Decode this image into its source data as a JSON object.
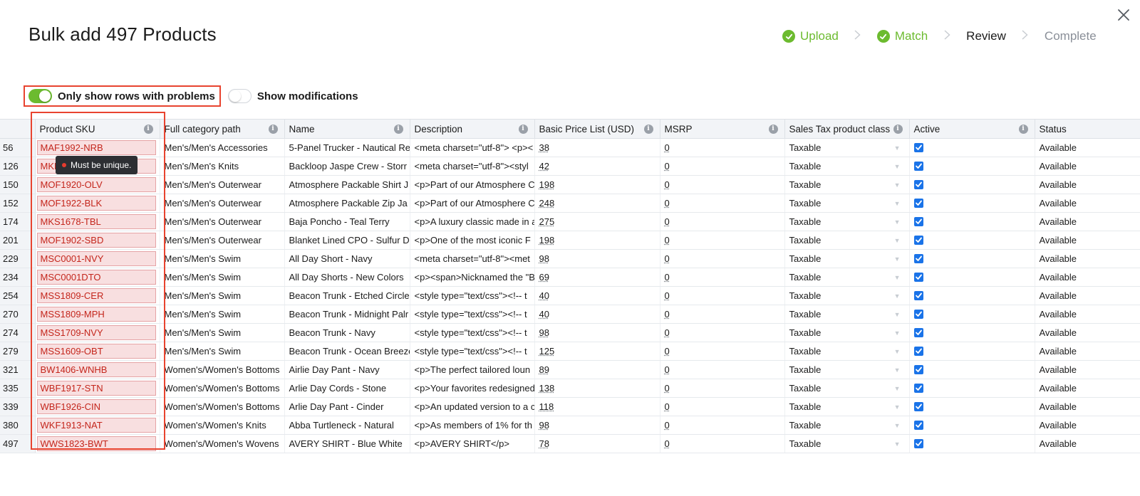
{
  "header": {
    "title": "Bulk add 497 Products",
    "steps": [
      {
        "label": "Upload",
        "state": "done"
      },
      {
        "label": "Match",
        "state": "done"
      },
      {
        "label": "Review",
        "state": "current"
      },
      {
        "label": "Complete",
        "state": "pending"
      }
    ]
  },
  "toggles": {
    "problems_label": "Only show rows with problems",
    "problems_on": true,
    "modifications_label": "Show modifications",
    "modifications_on": false
  },
  "tooltip": "Must be unique.",
  "columns": [
    "Product SKU",
    "Full category path",
    "Name",
    "Description",
    "Basic Price List (USD)",
    "MSRP",
    "Sales Tax product class",
    "Active",
    "Status"
  ],
  "rows": [
    {
      "num": "56",
      "sku": "MAF1992-NRB",
      "category": "Men's/Men's Accessories",
      "name": "5-Panel Trucker - Nautical Re",
      "description": "<meta charset=\"utf-8\"> <p><",
      "price": "38",
      "msrp": "0",
      "tax": "Taxable",
      "active": true,
      "status": "Available"
    },
    {
      "num": "126",
      "sku": "MKF",
      "category": "Men's/Men's Knits",
      "name": "Backloop Jaspe Crew - Storr",
      "description": "<meta charset=\"utf-8\"><styl",
      "price": "42",
      "msrp": "0",
      "tax": "Taxable",
      "active": true,
      "status": "Available"
    },
    {
      "num": "150",
      "sku": "MOF1920-OLV",
      "category": "Men's/Men's Outerwear",
      "name": "Atmosphere Packable Shirt J",
      "description": "<p>Part of our Atmosphere C",
      "price": "198",
      "msrp": "0",
      "tax": "Taxable",
      "active": true,
      "status": "Available"
    },
    {
      "num": "152",
      "sku": "MOF1922-BLK",
      "category": "Men's/Men's Outerwear",
      "name": "Atmosphere Packable Zip Ja",
      "description": "<p>Part of our Atmosphere C",
      "price": "248",
      "msrp": "0",
      "tax": "Taxable",
      "active": true,
      "status": "Available"
    },
    {
      "num": "174",
      "sku": "MKS1678-TBL",
      "category": "Men's/Men's Outerwear",
      "name": "Baja Poncho - Teal Terry",
      "description": "<p>A luxury classic made in a",
      "price": "275",
      "msrp": "0",
      "tax": "Taxable",
      "active": true,
      "status": "Available"
    },
    {
      "num": "201",
      "sku": "MOF1902-SBD",
      "category": "Men's/Men's Outerwear",
      "name": "Blanket Lined CPO - Sulfur D",
      "description": "<p>One of the most iconic F",
      "price": "198",
      "msrp": "0",
      "tax": "Taxable",
      "active": true,
      "status": "Available"
    },
    {
      "num": "229",
      "sku": "MSC0001-NVY",
      "category": "Men's/Men's Swim",
      "name": "All Day Short - Navy",
      "description": "<meta charset=\"utf-8\"><met",
      "price": "98",
      "msrp": "0",
      "tax": "Taxable",
      "active": true,
      "status": "Available"
    },
    {
      "num": "234",
      "sku": "MSC0001DTO",
      "category": "Men's/Men's Swim",
      "name": "All Day Shorts - New Colors",
      "description": "<p><span>Nicknamed the \"B",
      "price": "69",
      "msrp": "0",
      "tax": "Taxable",
      "active": true,
      "status": "Available"
    },
    {
      "num": "254",
      "sku": "MSS1809-CER",
      "category": "Men's/Men's Swim",
      "name": "Beacon Trunk - Etched Circle",
      "description": "<style type=\"text/css\"><!-- t",
      "price": "40",
      "msrp": "0",
      "tax": "Taxable",
      "active": true,
      "status": "Available"
    },
    {
      "num": "270",
      "sku": "MSS1809-MPH",
      "category": "Men's/Men's Swim",
      "name": "Beacon Trunk - Midnight Palr",
      "description": "<style type=\"text/css\"><!-- t",
      "price": "40",
      "msrp": "0",
      "tax": "Taxable",
      "active": true,
      "status": "Available"
    },
    {
      "num": "274",
      "sku": "MSS1709-NVY",
      "category": "Men's/Men's Swim",
      "name": "Beacon Trunk - Navy",
      "description": "<style type=\"text/css\"><!-- t",
      "price": "98",
      "msrp": "0",
      "tax": "Taxable",
      "active": true,
      "status": "Available"
    },
    {
      "num": "279",
      "sku": "MSS1609-OBT",
      "category": "Men's/Men's Swim",
      "name": "Beacon Trunk - Ocean Breeze",
      "description": "<style type=\"text/css\"><!-- t",
      "price": "125",
      "msrp": "0",
      "tax": "Taxable",
      "active": true,
      "status": "Available"
    },
    {
      "num": "321",
      "sku": "BW1406-WNHB",
      "category": "Women's/Women's Bottoms",
      "name": "Airlie Day Pant - Navy",
      "description": "<p>The perfect tailored loun",
      "price": "89",
      "msrp": "0",
      "tax": "Taxable",
      "active": true,
      "status": "Available"
    },
    {
      "num": "335",
      "sku": "WBF1917-STN",
      "category": "Women's/Women's Bottoms",
      "name": "Arlie Day Cords - Stone",
      "description": "<p>Your favorites redesigned",
      "price": "138",
      "msrp": "0",
      "tax": "Taxable",
      "active": true,
      "status": "Available"
    },
    {
      "num": "339",
      "sku": "WBF1926-CIN",
      "category": "Women's/Women's Bottoms",
      "name": "Arlie Day Pant - Cinder",
      "description": "<p>An updated version to a c",
      "price": "118",
      "msrp": "0",
      "tax": "Taxable",
      "active": true,
      "status": "Available"
    },
    {
      "num": "380",
      "sku": "WKF1913-NAT",
      "category": "Women's/Women's Knits",
      "name": "Abba Turtleneck - Natural",
      "description": "<p>As members of 1% for th",
      "price": "98",
      "msrp": "0",
      "tax": "Taxable",
      "active": true,
      "status": "Available"
    },
    {
      "num": "497",
      "sku": "WWS1823-BWT",
      "category": "Women's/Women's Wovens",
      "name": "AVERY SHIRT - Blue White",
      "description": "<p>AVERY SHIRT</p>",
      "price": "78",
      "msrp": "0",
      "tax": "Taxable",
      "active": true,
      "status": "Available"
    }
  ],
  "colors": {
    "accent_green": "#6cbb2f",
    "error_red": "#c4261c",
    "highlight_outline": "#e8432f",
    "checkbox_blue": "#1a73e8"
  }
}
